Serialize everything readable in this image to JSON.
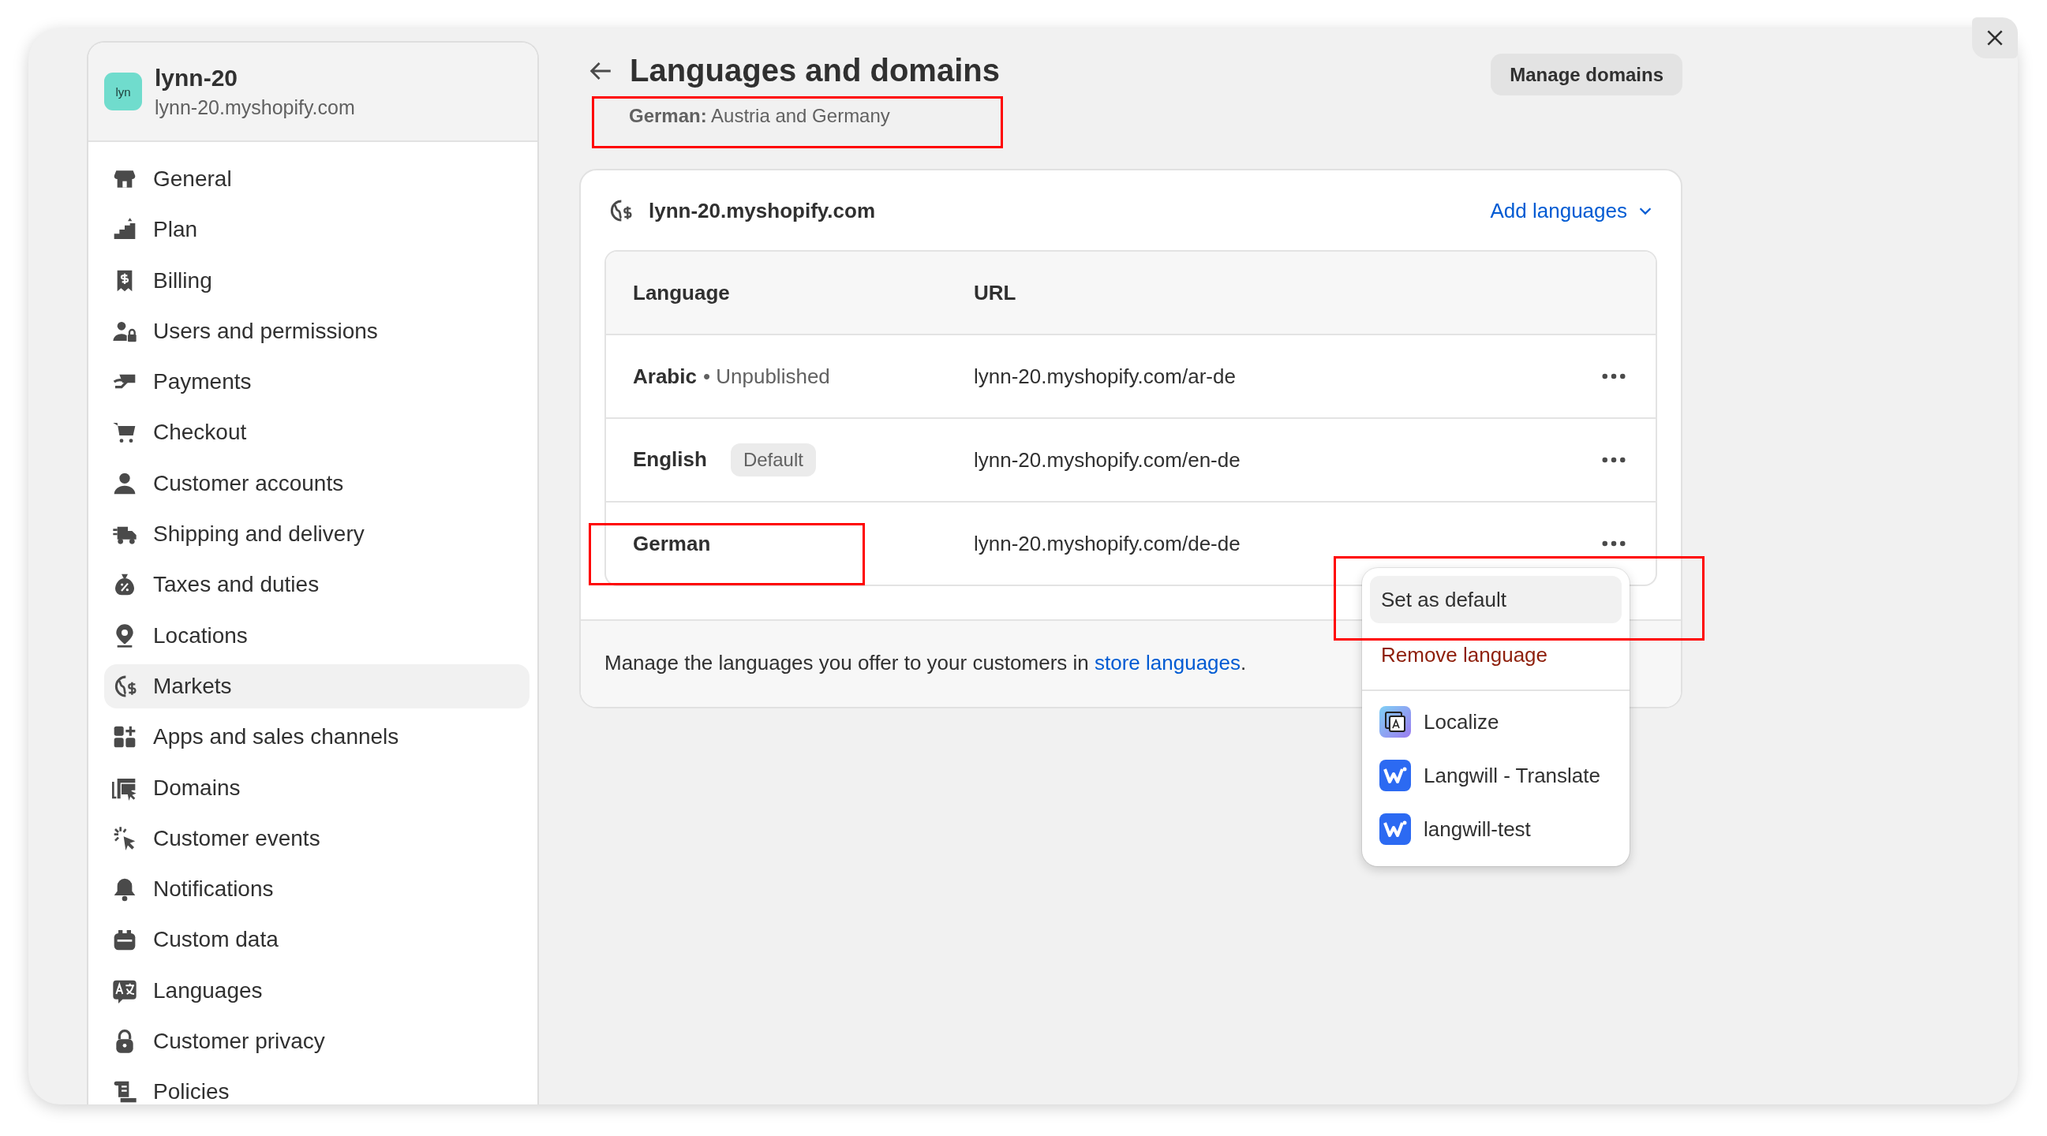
{
  "store": {
    "avatar": "lyn",
    "name": "lynn-20",
    "domain": "lynn-20.myshopify.com"
  },
  "sidebar": {
    "items": [
      {
        "label": "General",
        "selected": false
      },
      {
        "label": "Plan",
        "selected": false
      },
      {
        "label": "Billing",
        "selected": false
      },
      {
        "label": "Users and permissions",
        "selected": false
      },
      {
        "label": "Payments",
        "selected": false
      },
      {
        "label": "Checkout",
        "selected": false
      },
      {
        "label": "Customer accounts",
        "selected": false
      },
      {
        "label": "Shipping and delivery",
        "selected": false
      },
      {
        "label": "Taxes and duties",
        "selected": false
      },
      {
        "label": "Locations",
        "selected": false
      },
      {
        "label": "Markets",
        "selected": true
      },
      {
        "label": "Apps and sales channels",
        "selected": false
      },
      {
        "label": "Domains",
        "selected": false
      },
      {
        "label": "Customer events",
        "selected": false
      },
      {
        "label": "Notifications",
        "selected": false
      },
      {
        "label": "Custom data",
        "selected": false
      },
      {
        "label": "Languages",
        "selected": false
      },
      {
        "label": "Customer privacy",
        "selected": false
      },
      {
        "label": "Policies",
        "selected": false
      }
    ]
  },
  "page": {
    "title": "Languages and domains",
    "subtitle": "**German:** Austria and Germany",
    "action": "Manage domains"
  },
  "card": {
    "domain": "lynn-20.myshopify.com",
    "add_languages": "Add languages",
    "table": {
      "columns": [
        "Language",
        "URL"
      ],
      "rows": [
        {
          "language": "Arabic",
          "status": "• Unpublished",
          "url": "lynn-20.myshopify.com/ar-de"
        },
        {
          "language": "English",
          "badge": "Default",
          "url": "lynn-20.myshopify.com/en-de"
        },
        {
          "language": "German",
          "url": "lynn-20.myshopify.com/de-de"
        }
      ]
    },
    "footer": {
      "text": "Manage the languages you offer to your customers in ",
      "link": "store languages",
      "end": "."
    }
  },
  "menu": {
    "items": [
      {
        "label": "Set as default",
        "kind": "action",
        "selected": true
      },
      {
        "label": "Remove language",
        "kind": "destructive",
        "selected": false
      },
      {
        "label": "Localize",
        "kind": "app",
        "selected": false
      },
      {
        "label": "Langwill - Translate",
        "kind": "app",
        "selected": false
      },
      {
        "label": "langwill-test",
        "kind": "app",
        "selected": false
      }
    ]
  }
}
